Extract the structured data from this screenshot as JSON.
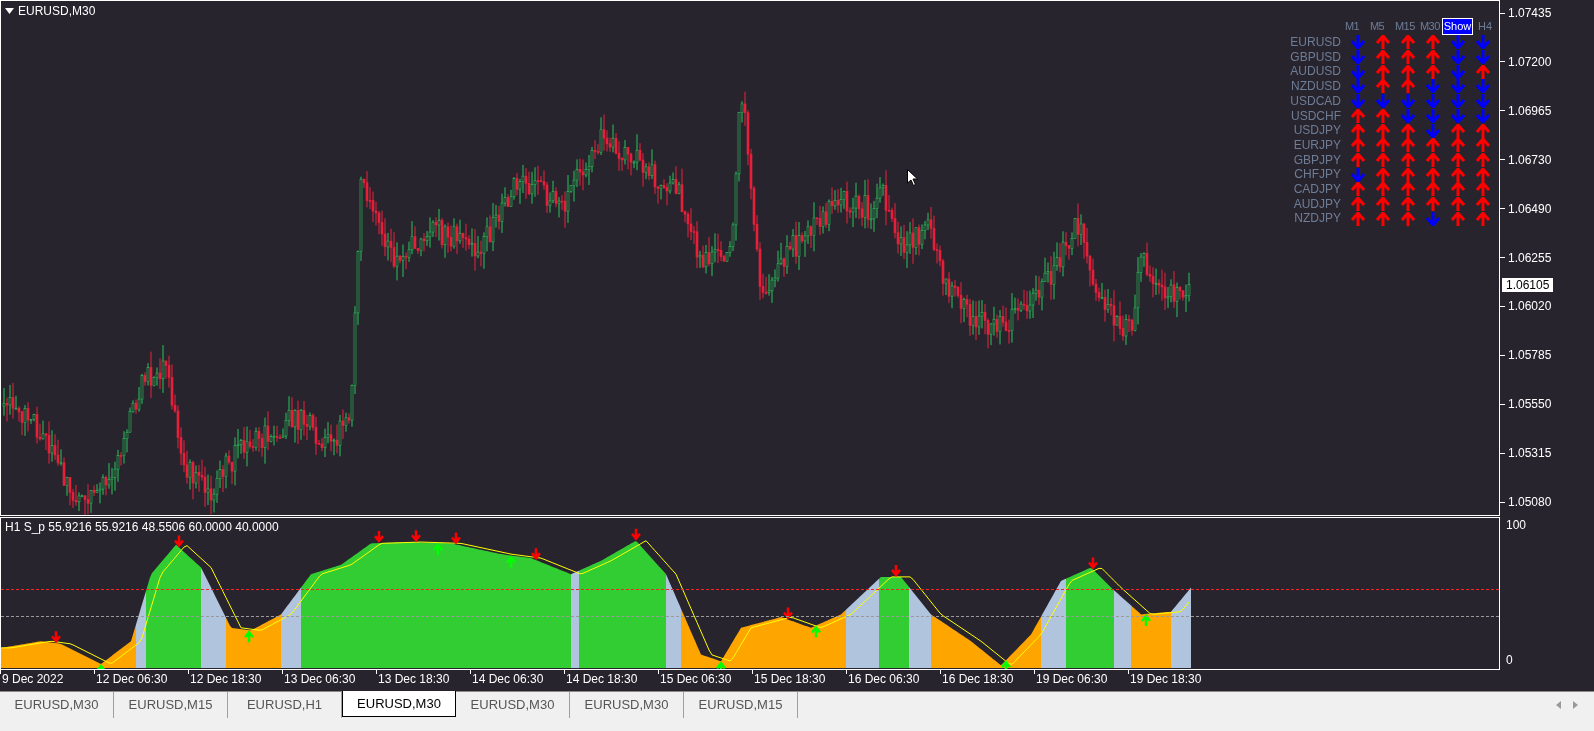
{
  "chart": {
    "title": "EURUSD,M30",
    "current_price": "1.06105"
  },
  "dashboard": {
    "headers": [
      "M1",
      "M5",
      "M15",
      "M30",
      "H4"
    ],
    "show_button": "Show",
    "rows": [
      {
        "pair": "EURUSD",
        "up": [
          false,
          true,
          true,
          true,
          false,
          false
        ]
      },
      {
        "pair": "GBPUSD",
        "up": [
          false,
          true,
          true,
          true,
          false,
          false
        ]
      },
      {
        "pair": "AUDUSD",
        "up": [
          false,
          true,
          true,
          true,
          false,
          true
        ]
      },
      {
        "pair": "NZDUSD",
        "up": [
          false,
          true,
          true,
          false,
          false,
          false
        ]
      },
      {
        "pair": "USDCAD",
        "up": [
          false,
          false,
          false,
          false,
          false,
          false
        ]
      },
      {
        "pair": "USDCHF",
        "up": [
          true,
          true,
          false,
          false,
          false,
          false
        ]
      },
      {
        "pair": "USDJPY",
        "up": [
          true,
          true,
          true,
          false,
          true,
          true
        ]
      },
      {
        "pair": "EURJPY",
        "up": [
          true,
          true,
          true,
          true,
          true,
          true
        ]
      },
      {
        "pair": "GBPJPY",
        "up": [
          true,
          true,
          true,
          true,
          true,
          true
        ]
      },
      {
        "pair": "CHFJPY",
        "up": [
          false,
          true,
          true,
          true,
          true,
          true
        ]
      },
      {
        "pair": "CADJPY",
        "up": [
          true,
          true,
          true,
          true,
          true,
          true
        ]
      },
      {
        "pair": "AUDJPY",
        "up": [
          true,
          true,
          true,
          true,
          true,
          true
        ]
      },
      {
        "pair": "NZDJPY",
        "up": [
          true,
          true,
          true,
          false,
          true,
          true
        ]
      }
    ]
  },
  "price_axis": [
    "1.07435",
    "1.07200",
    "1.06965",
    "1.06730",
    "1.06490",
    "1.06255",
    "1.06020",
    "1.05785",
    "1.05550",
    "1.05315",
    "1.05080"
  ],
  "indicator": {
    "label": "H1 S_p 55.9216 55.9216 48.5506 60.0000 40.0000",
    "axis": [
      "100",
      "0"
    ]
  },
  "time_axis": [
    "9 Dec 2022",
    "12 Dec 06:30",
    "12 Dec 18:30",
    "13 Dec 06:30",
    "13 Dec 18:30",
    "14 Dec 06:30",
    "14 Dec 18:30",
    "15 Dec 06:30",
    "15 Dec 18:30",
    "16 Dec 06:30",
    "16 Dec 18:30",
    "19 Dec 06:30",
    "19 Dec 18:30"
  ],
  "tabs": [
    {
      "label": "EURUSD,M30",
      "selected": false
    },
    {
      "label": "EURUSD,M15",
      "selected": false
    },
    {
      "label": "EURUSD,H1",
      "selected": false
    },
    {
      "label": "EURUSD,M30",
      "selected": true
    },
    {
      "label": "EURUSD,M30",
      "selected": false
    },
    {
      "label": "EURUSD,M30",
      "selected": false
    },
    {
      "label": "EURUSD,M15",
      "selected": false
    }
  ]
}
